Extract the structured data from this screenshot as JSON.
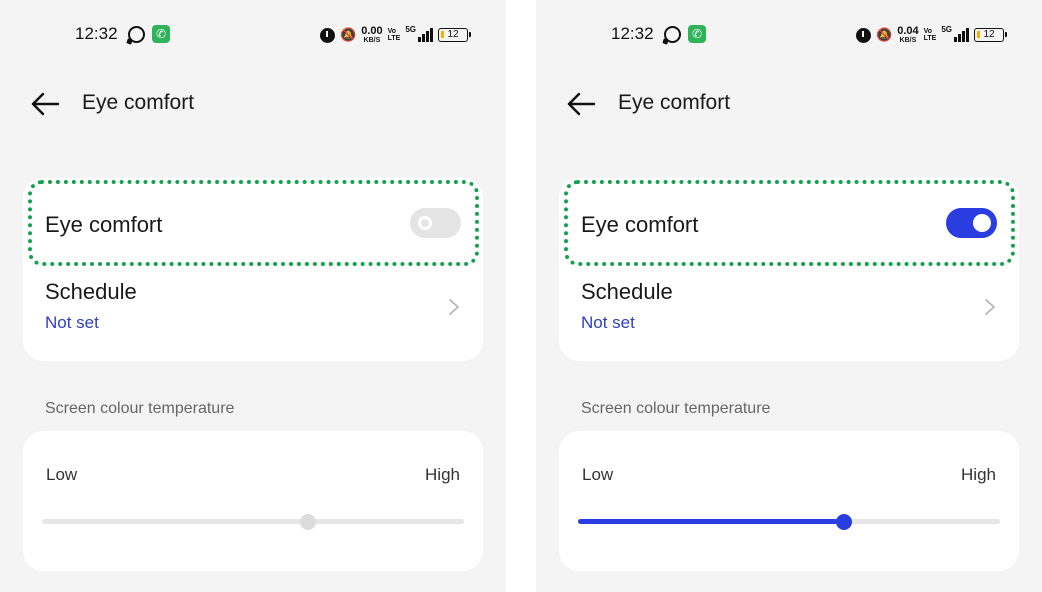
{
  "panels": [
    {
      "status_bar": {
        "time": "12:32",
        "speed_value": "0.00",
        "speed_unit": "KB/S",
        "volte_top": "Vo",
        "volte_bottom": "LTE",
        "network": "5G",
        "battery": "12"
      },
      "header": {
        "title": "Eye comfort"
      },
      "eye_comfort": {
        "label": "Eye comfort",
        "toggle_on": false
      },
      "schedule": {
        "label": "Schedule",
        "value": "Not set"
      },
      "temperature": {
        "section_label": "Screen colour temperature",
        "low_label": "Low",
        "high_label": "High",
        "level": 0.63,
        "active": false
      }
    },
    {
      "status_bar": {
        "time": "12:32",
        "speed_value": "0.04",
        "speed_unit": "KB/S",
        "volte_top": "Vo",
        "volte_bottom": "LTE",
        "network": "5G",
        "battery": "12"
      },
      "header": {
        "title": "Eye comfort"
      },
      "eye_comfort": {
        "label": "Eye comfort",
        "toggle_on": true
      },
      "schedule": {
        "label": "Schedule",
        "value": "Not set"
      },
      "temperature": {
        "section_label": "Screen colour temperature",
        "low_label": "Low",
        "high_label": "High",
        "level": 0.63,
        "active": true
      }
    }
  ],
  "colors": {
    "accent": "#2a3de0",
    "highlight_border": "#13a150",
    "link_text": "#2e3fbf",
    "background": "#f4f4f4"
  }
}
